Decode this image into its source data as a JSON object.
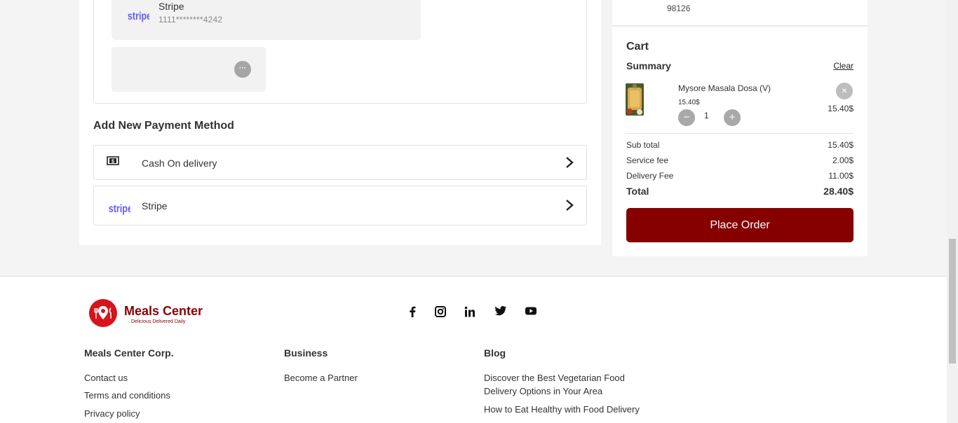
{
  "saved_methods": {
    "card": {
      "name": "Stripe",
      "number": "1111********4242",
      "logo_text": "stripe"
    },
    "more_icon": "ellipsis-icon"
  },
  "add_payment": {
    "title": "Add New Payment Method",
    "methods": [
      {
        "label": "Cash On delivery",
        "icon": "cash-icon"
      },
      {
        "label": "Stripe",
        "icon": "stripe-logo",
        "logo_text": "stripe"
      }
    ]
  },
  "address": {
    "zip": "98126"
  },
  "cart": {
    "title": "Cart",
    "summary_label": "Summary",
    "clear_label": "Clear",
    "item": {
      "name": "Mysore Masala Dosa (V)",
      "unit_price": "15.40$",
      "quantity": "1",
      "line_total": "15.40$",
      "minus": "−",
      "plus": "+",
      "remove": "×"
    },
    "rows": [
      {
        "label": "Sub total",
        "value": "15.40$"
      },
      {
        "label": "Service fee",
        "value": "2.00$"
      },
      {
        "label": "Delivery Fee",
        "value": "11.00$"
      }
    ],
    "total": {
      "label": "Total",
      "value": "28.40$"
    },
    "place_order_label": "Place Order"
  },
  "footer": {
    "brand_name": "Meals Center",
    "brand_tagline": "Delicious Delivered Daily",
    "social": [
      "facebook-icon",
      "instagram-icon",
      "linkedin-icon",
      "twitter-icon",
      "youtube-icon"
    ],
    "columns": [
      {
        "title": "Meals Center Corp.",
        "links": [
          "Contact us",
          "Terms and conditions",
          "Privacy policy"
        ]
      },
      {
        "title": "Business",
        "links": [
          "Become a Partner"
        ]
      },
      {
        "title": "Blog",
        "links": [
          "Discover the Best Vegetarian Food",
          "Delivery Options in Your Area",
          "How to Eat Healthy with Food Delivery"
        ]
      }
    ]
  },
  "colors": {
    "accent": "#860000",
    "stripe": "#635bff"
  }
}
